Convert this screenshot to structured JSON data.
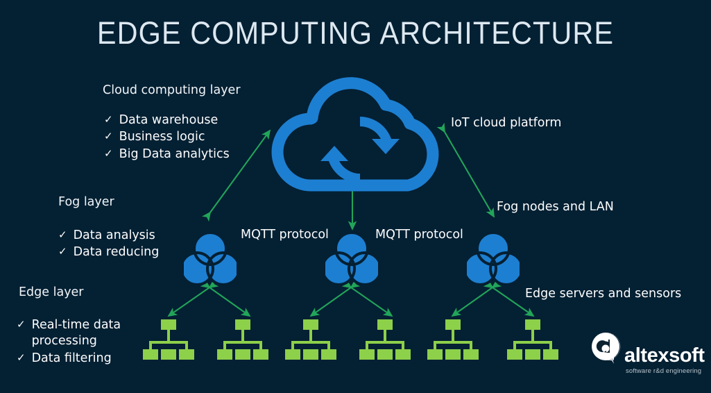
{
  "title": "EDGE COMPUTING ARCHITECTURE",
  "colors": {
    "background": "#042033",
    "title": "#dde8f0",
    "text": "#ffffff",
    "blue": "#1d7fd1",
    "green_arrow": "#22a559",
    "green_node": "#8dd04a",
    "logo_text": "#ffffff",
    "logo_tagline": "#b9c4cc"
  },
  "layers": {
    "cloud": {
      "heading": "Cloud computing layer",
      "bullets": [
        "Data warehouse",
        "Business logic",
        "Big Data analytics"
      ],
      "check_glyph": "✓"
    },
    "fog": {
      "heading": "Fog layer",
      "bullets": [
        "Data analysis",
        "Data reducing"
      ],
      "check_glyph": "✓"
    },
    "edge": {
      "heading": "Edge layer",
      "bullets": [
        "Real-time data\nprocessing",
        "Data filtering"
      ],
      "check_glyph": "✓"
    }
  },
  "right_labels": {
    "iot": "IoT cloud platform",
    "fog_nodes": "Fog nodes and LAN",
    "edge_servers": "Edge servers and sensors"
  },
  "protocol_labels": {
    "left": "MQTT protocol",
    "right": "MQTT protocol"
  },
  "icons": {
    "cloud": "cloud-sync-icon",
    "fog_node": "three-circles-venn-icon",
    "edge_cluster": "server-tree-icon",
    "arrow": "double-headed-arrow"
  },
  "logo": {
    "name": "altexsoft",
    "tagline": "software r&d engineering",
    "mark": "altexsoft-bubble-a-mark"
  }
}
